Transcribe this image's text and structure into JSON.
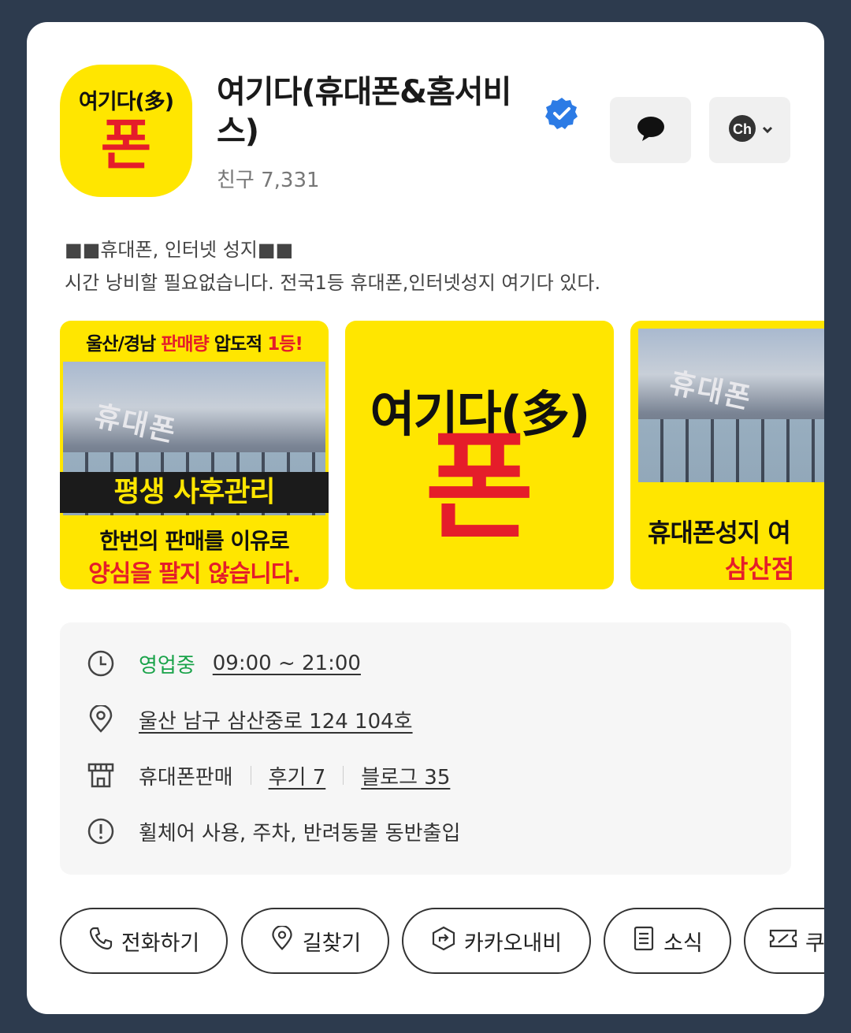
{
  "channel": {
    "logo_top": "여기다(多)",
    "logo_big": "폰",
    "title": "여기다(휴대폰&홈서비스)",
    "friends": "친구 7,331"
  },
  "description": {
    "line1": "■■휴대폰, 인터넷  성지■■",
    "line2": "시간 낭비할 필요없습니다. 전국1등 휴대폰,인터넷성지 여기다 있다."
  },
  "gallery": {
    "tile1": {
      "head_prefix": "울산/경남 ",
      "head_red": "판매량",
      "head_suffix": " 압도적 ",
      "head_red2": "1등!",
      "photo_sign": "휴대폰",
      "banner": "평생 사후관리",
      "foot1": "한번의 판매를 이유로",
      "foot2": "양심을 팔지 않습니다."
    },
    "tile2": {
      "top": "여기다(多)",
      "big": "폰"
    },
    "tile3": {
      "photo_sign": "휴대폰",
      "foot1": "휴대폰성지 여",
      "foot2": "삼산점"
    }
  },
  "info": {
    "status": "영업중",
    "hours": "09:00 ~ 21:00",
    "address": "울산 남구 삼산중로 124 104호",
    "category": "휴대폰판매",
    "reviews": "후기 7",
    "blog": "블로그 35",
    "amenities": "휠체어 사용, 주차, 반려동물 동반출입"
  },
  "actions": {
    "call": "전화하기",
    "directions": "길찾기",
    "kakaonavi": "카카오내비",
    "news": "소식",
    "coupon": "쿠"
  },
  "colors": {
    "brand_yellow": "#ffe600",
    "brand_red": "#e51d2a",
    "open_green": "#1aa34a",
    "verified_blue": "#2c7be5",
    "background": "#2d3b4e"
  }
}
